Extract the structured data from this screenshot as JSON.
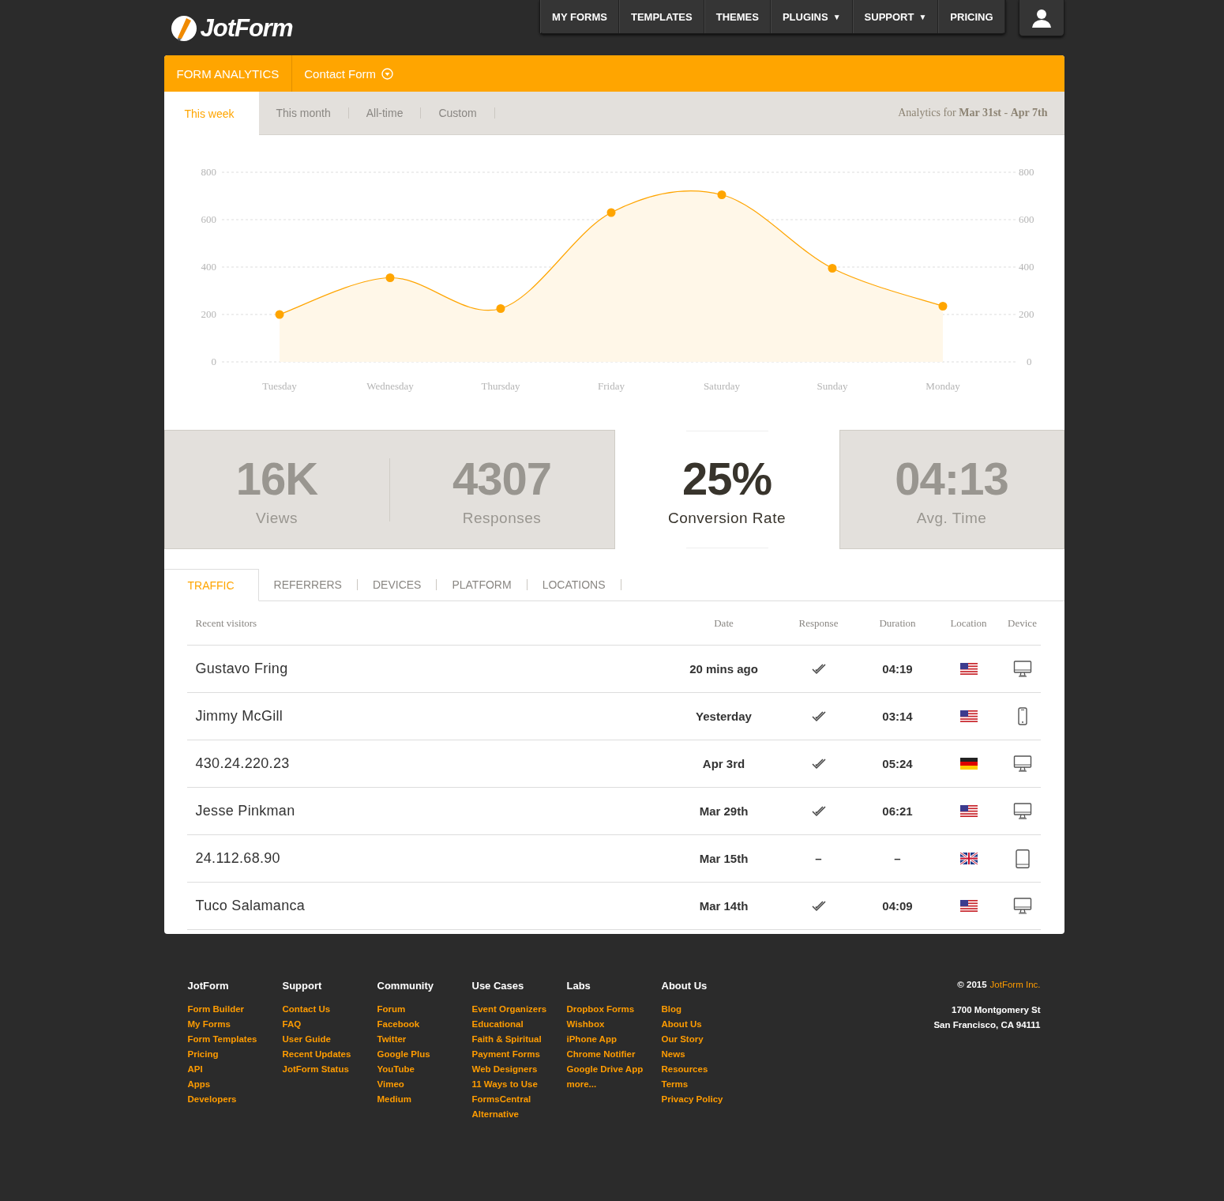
{
  "logo": {
    "text": "JotForm"
  },
  "nav": [
    {
      "label": "MY FORMS"
    },
    {
      "label": "TEMPLATES"
    },
    {
      "label": "THEMES"
    },
    {
      "label": "PLUGINS",
      "caret": "▼"
    },
    {
      "label": "SUPPORT",
      "caret": "▼"
    },
    {
      "label": "PRICING"
    }
  ],
  "header": {
    "title": "FORM ANALYTICS",
    "form": "Contact Form"
  },
  "periods": [
    {
      "label": "This week",
      "selected": true
    },
    {
      "label": "This month",
      "selected": false
    },
    {
      "label": "All-time",
      "selected": false
    },
    {
      "label": "Custom",
      "selected": false
    }
  ],
  "range": {
    "prefix": "Analytics for",
    "text": "**Mar 31st** - **Apr 7th**"
  },
  "chart_data": {
    "type": "area",
    "categories": [
      "Tuesday",
      "Wednesday",
      "Thursday",
      "Friday",
      "Saturday",
      "Sunday",
      "Monday"
    ],
    "series": [
      {
        "color": "#ffa500",
        "values": [
          200,
          355,
          225,
          630,
          705,
          395,
          235
        ]
      }
    ],
    "ylim": [
      0,
      800
    ],
    "yticks": [
      0,
      200,
      400,
      600,
      800
    ],
    "y2ticks": [
      0,
      200,
      400,
      600,
      800
    ],
    "y2lim": [
      0,
      800
    ],
    "grid": true
  },
  "stats": [
    {
      "value": "16K",
      "label": "Views",
      "highlight": false
    },
    {
      "value": "4307",
      "label": "Responses",
      "highlight": false
    },
    {
      "value": "25%",
      "label": "Conversion Rate",
      "highlight": true
    },
    {
      "value": "04:13",
      "label": "Avg. Time",
      "highlight": false
    }
  ],
  "tabs": [
    {
      "label": "TRAFFIC",
      "selected": true
    },
    {
      "label": "REFERRERS",
      "selected": false
    },
    {
      "label": "DEVICES",
      "selected": false
    },
    {
      "label": "PLATFORM",
      "selected": false
    },
    {
      "label": "LOCATIONS",
      "selected": false
    }
  ],
  "table": {
    "columns": [
      "Recent visitors",
      "Date",
      "Response",
      "Duration",
      "Location",
      "Device"
    ],
    "rows": [
      {
        "visitor": "Gustavo Fring",
        "date": "20 mins ago",
        "response": {
          "kind": "check"
        },
        "duration": "04:19",
        "flag": {
          "kind": "us"
        },
        "device": {
          "kind": "desktop"
        }
      },
      {
        "visitor": "Jimmy McGill",
        "date": "Yesterday",
        "response": {
          "kind": "check"
        },
        "duration": "03:14",
        "flag": {
          "kind": "us"
        },
        "device": {
          "kind": "phone"
        }
      },
      {
        "visitor": "430.24.220.23",
        "date": "Apr 3rd",
        "response": {
          "kind": "check"
        },
        "duration": "05:24",
        "flag": {
          "kind": "de"
        },
        "device": {
          "kind": "desktop"
        }
      },
      {
        "visitor": "Jesse Pinkman",
        "date": "Mar 29th",
        "response": {
          "kind": "check"
        },
        "duration": "06:21",
        "flag": {
          "kind": "us"
        },
        "device": {
          "kind": "desktop"
        }
      },
      {
        "visitor": "24.112.68.90",
        "date": "Mar 15th",
        "response": {
          "kind": "text",
          "text": "–"
        },
        "duration": "–",
        "flag": {
          "kind": "gb"
        },
        "device": {
          "kind": "tablet"
        }
      },
      {
        "visitor": "Tuco Salamanca",
        "date": "Mar 14th",
        "response": {
          "kind": "check"
        },
        "duration": "04:09",
        "flag": {
          "kind": "us"
        },
        "device": {
          "kind": "desktop"
        }
      }
    ]
  },
  "footer": {
    "columns": [
      {
        "heading": "JotForm",
        "links": [
          "Form Builder",
          "My Forms",
          "Form Templates",
          "Pricing",
          "API",
          "Apps",
          "Developers"
        ]
      },
      {
        "heading": "Support",
        "links": [
          "Contact Us",
          "FAQ",
          "User Guide",
          "Recent Updates",
          "JotForm Status"
        ]
      },
      {
        "heading": "Community",
        "links": [
          "Forum",
          "Facebook",
          "Twitter",
          "Google Plus",
          "YouTube",
          "Vimeo",
          "Medium"
        ]
      },
      {
        "heading": "Use Cases",
        "links": [
          "Event Organizers",
          "Educational",
          "Faith & Spiritual",
          "Payment Forms",
          "Web Designers",
          "11 Ways to Use",
          "FormsCentral",
          "Alternative"
        ]
      },
      {
        "heading": "Labs",
        "links": [
          "Dropbox Forms",
          "Wishbox",
          "iPhone App",
          "Chrome Notifier",
          "Google Drive App",
          "more..."
        ]
      },
      {
        "heading": "About Us",
        "links": [
          "Blog",
          "About Us",
          "Our Story",
          "News",
          "Resources",
          "Terms",
          "Privacy Policy"
        ]
      }
    ],
    "copyright": "© 2015",
    "company": "JotForm Inc.",
    "address": [
      "1700 Montgomery St",
      "San Francisco, CA 94111"
    ]
  }
}
